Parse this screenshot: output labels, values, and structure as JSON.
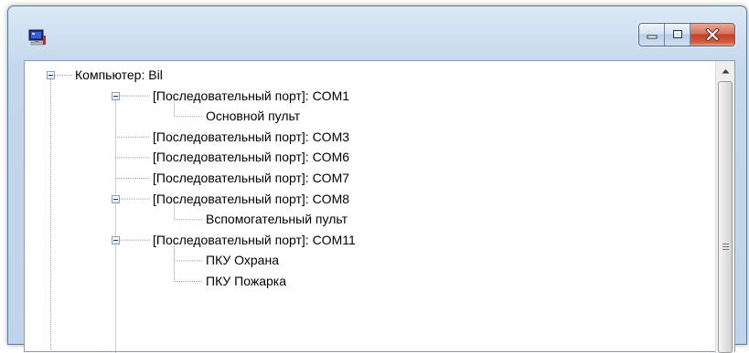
{
  "window": {
    "title": "",
    "icon": "computer-app-icon",
    "buttons": [
      "minimize-icon",
      "maximize-icon",
      "close-icon"
    ]
  },
  "tree": {
    "nodes": [
      {
        "label": "Компьютер: Bil",
        "level": 0,
        "expanded": true
      },
      {
        "label": "[Последовательный порт]: COM1",
        "level": 1,
        "expanded": true
      },
      {
        "label": "Основной пульт",
        "level": 2
      },
      {
        "label": "[Последовательный порт]: COM3",
        "level": 1
      },
      {
        "label": "[Последовательный порт]: COM6",
        "level": 1
      },
      {
        "label": "[Последовательный порт]: COM7",
        "level": 1
      },
      {
        "label": "[Последовательный порт]: COM8",
        "level": 1,
        "expanded": true
      },
      {
        "label": "Вспомогательный пульт",
        "level": 2
      },
      {
        "label": "[Последовательный порт]: COM11",
        "level": 1,
        "expanded": true
      },
      {
        "label": "ПКУ Охрана",
        "level": 2
      },
      {
        "label": "ПКУ Пожарка",
        "level": 2
      }
    ]
  },
  "colors": {
    "tree_line": "#a0a0a0",
    "close_button": "#c2432a"
  }
}
